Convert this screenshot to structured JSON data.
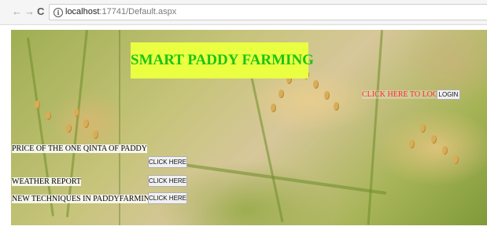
{
  "browser": {
    "url_host": "localhost",
    "url_path": ":17741/Default.aspx",
    "back_glyph": "←",
    "forward_glyph": "→",
    "reload_glyph": "C",
    "info_glyph": "i"
  },
  "page": {
    "title": "SMART PADDY FARMING",
    "login_prompt": "CLICK HERE TO LOGIN",
    "login_button": "LOGIN",
    "links": [
      {
        "label": "PRICE OF THE ONE QINTA OF PADDY",
        "button": "CLICK HERE"
      },
      {
        "label": "WEATHER REPORT",
        "button": "CLICK HERE"
      },
      {
        "label": "NEW TECHNIQUES IN PADDYFARMING",
        "button": "CLICK HERE"
      }
    ]
  },
  "colors": {
    "title_background": "#eaff42",
    "title_text": "#1cc412",
    "login_prompt": "#ff2a2a"
  },
  "icons": [
    "back-arrow-icon",
    "forward-arrow-icon",
    "reload-icon",
    "info-icon"
  ]
}
